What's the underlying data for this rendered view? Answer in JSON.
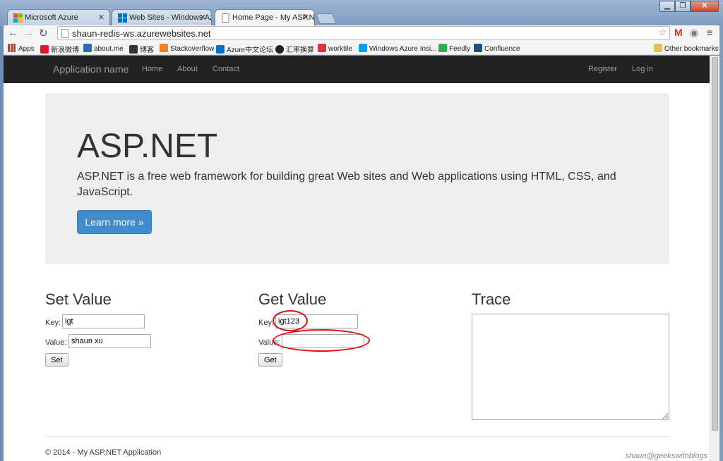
{
  "browser": {
    "tabs": [
      {
        "label": "Microsoft Azure",
        "active": false
      },
      {
        "label": "Web Sites - Windows Azu",
        "active": false
      },
      {
        "label": "Home Page - My ASP.NET",
        "active": true
      }
    ],
    "url": "shaun-redis-ws.azurewebsites.net",
    "bookmarks": [
      {
        "label": "Apps",
        "color": "#c0392b"
      },
      {
        "label": "新浪微博",
        "color": "#e6162d"
      },
      {
        "label": "about.me",
        "color": "#2a6ab0"
      },
      {
        "label": "博客",
        "color": "#333333"
      },
      {
        "label": "Stackoverflow",
        "color": "#f48024"
      },
      {
        "label": "Azure中文论坛",
        "color": "#0072c6"
      },
      {
        "label": "汇率换算",
        "color": "#222222"
      },
      {
        "label": "worktile",
        "color": "#d9363e"
      },
      {
        "label": "Windows Azure Insi...",
        "color": "#00a1f1"
      },
      {
        "label": "Feedly",
        "color": "#2bb24c"
      },
      {
        "label": "Confluence",
        "color": "#205081"
      }
    ],
    "other_bookmarks": "Other bookmarks"
  },
  "navbar": {
    "brand": "Application name",
    "links": [
      "Home",
      "About",
      "Contact"
    ],
    "register": "Register",
    "login": "Log in"
  },
  "jumbotron": {
    "title": "ASP.NET",
    "lead": "ASP.NET is a free web framework for building great Web sites and Web applications using HTML, CSS, and JavaScript.",
    "button": "Learn more »"
  },
  "set_value": {
    "heading": "Set Value",
    "key_label": "Key:",
    "key_value": "igt",
    "value_label": "Value:",
    "value_value": "shaun xu",
    "button": "Set"
  },
  "get_value": {
    "heading": "Get Value",
    "key_label": "Key:",
    "key_value": "igt123",
    "value_label": "Value:",
    "value_value": "",
    "button": "Get"
  },
  "trace": {
    "heading": "Trace"
  },
  "footer": {
    "text": "© 2014 - My ASP.NET Application"
  },
  "watermark": "shaun@geekswithblogs",
  "colors": {
    "navbar_bg": "#222222",
    "primary": "#428bca",
    "annotation": "#e01010"
  }
}
